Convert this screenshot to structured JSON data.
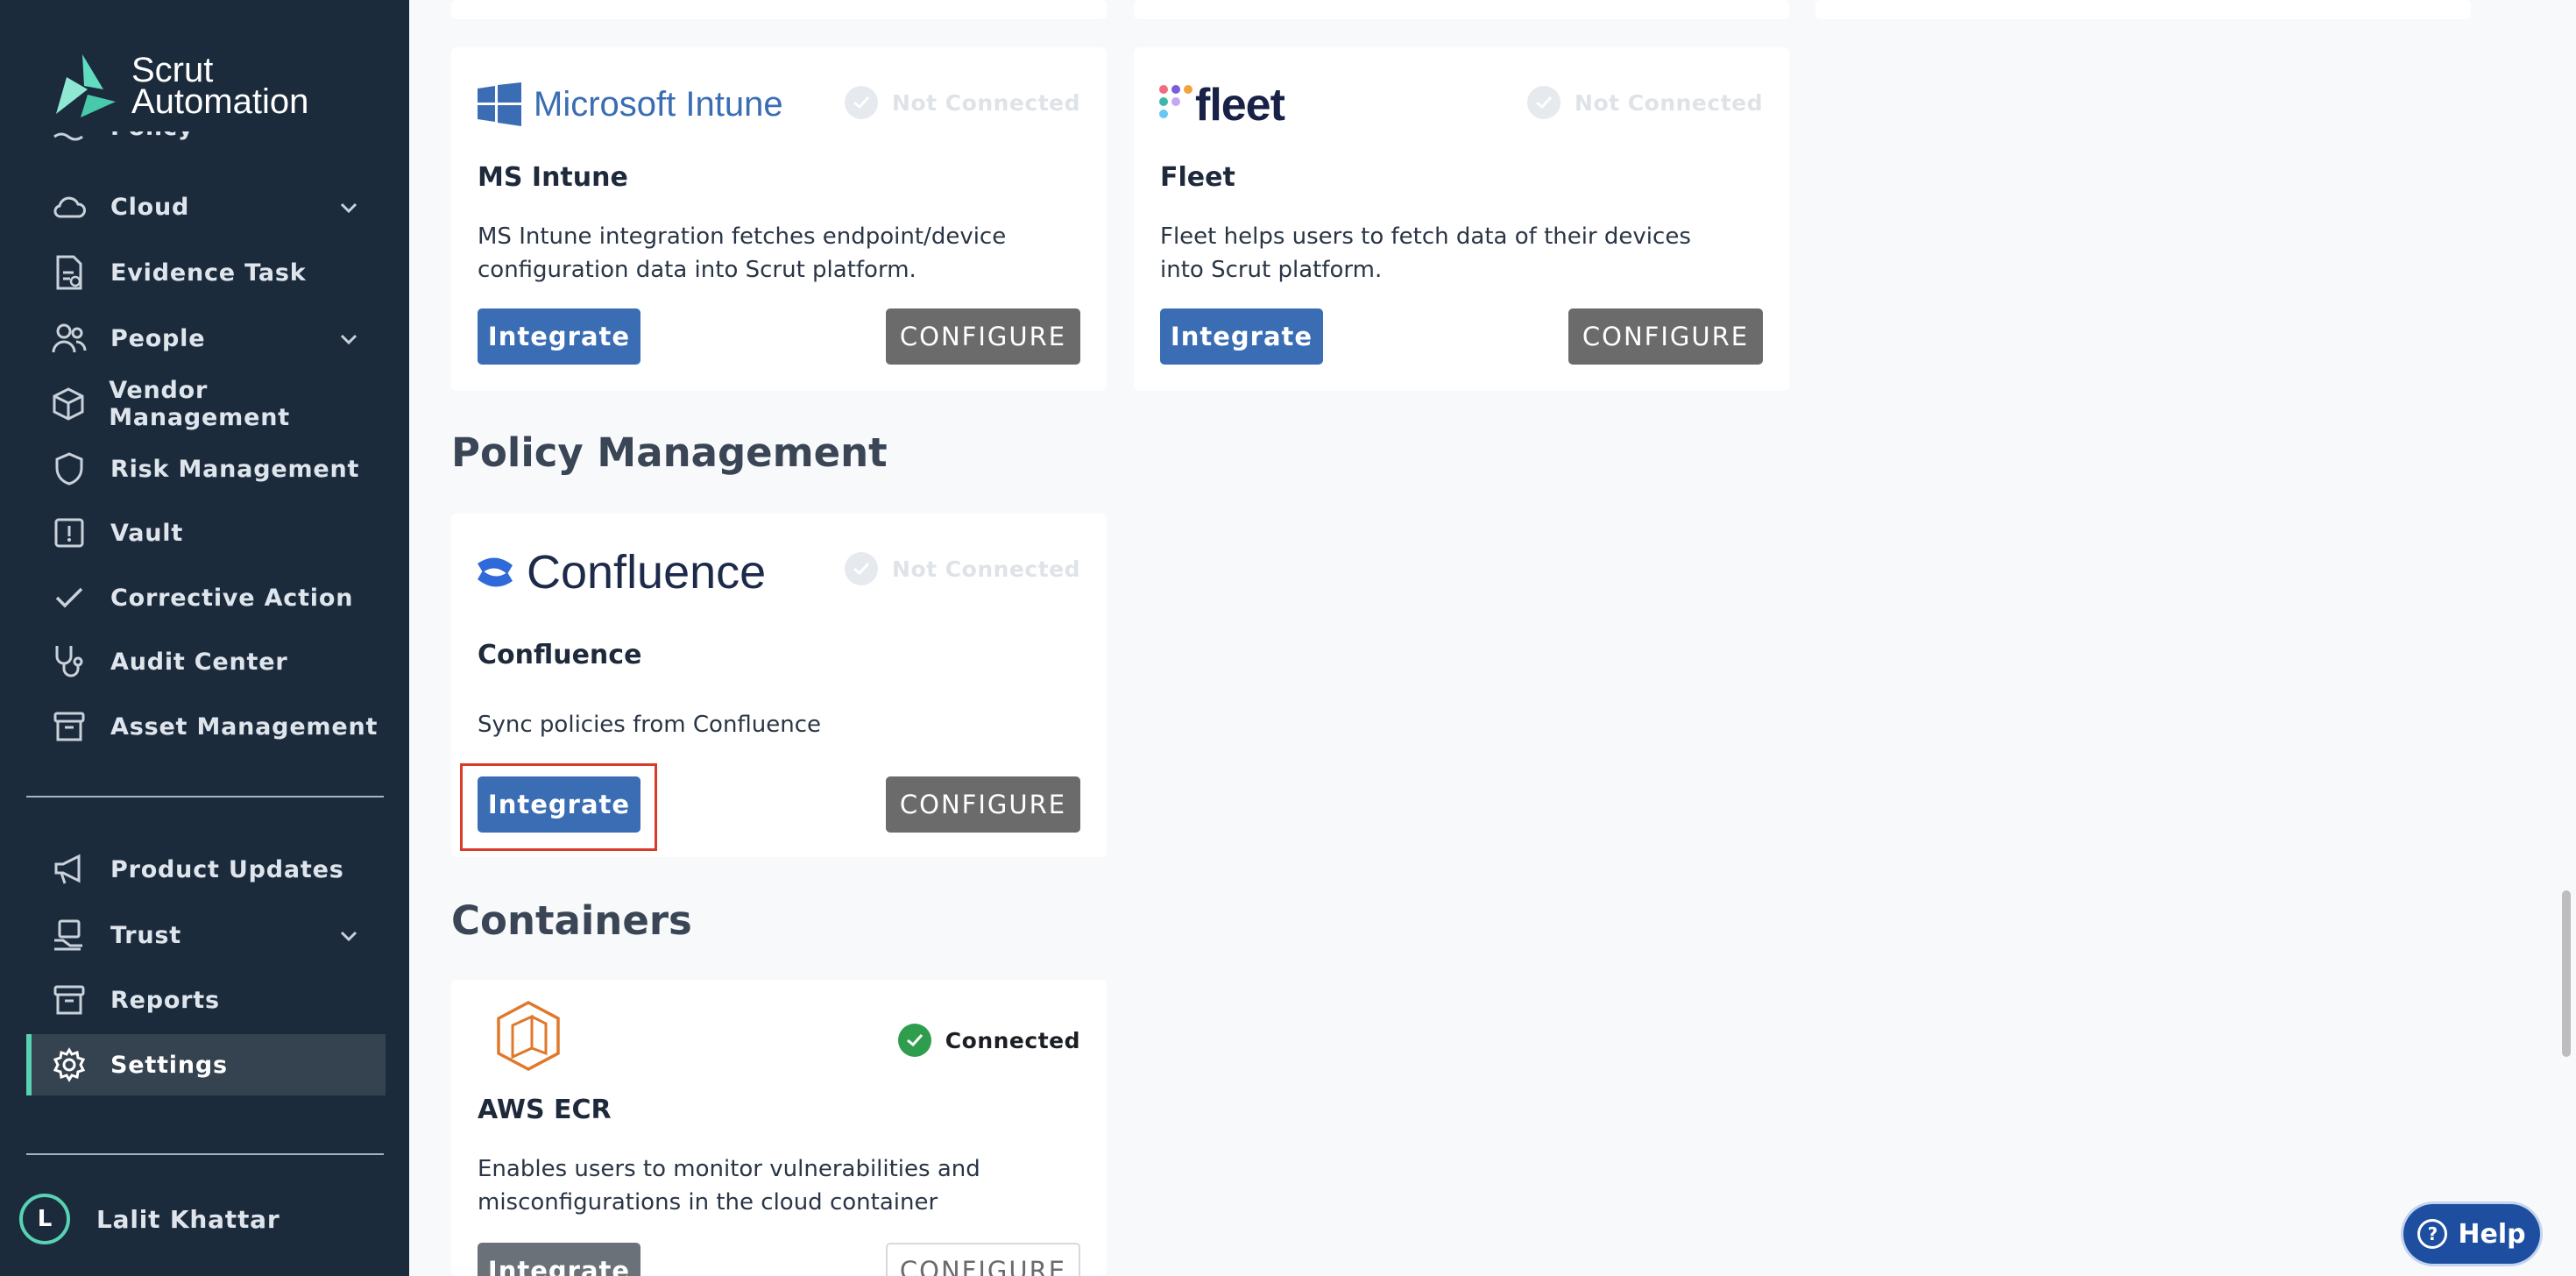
{
  "brand": {
    "line1": "Scrut",
    "line2": "Automation"
  },
  "sidebar": {
    "cut_label": "Policy",
    "items": [
      {
        "label": "Cloud",
        "icon": "cloud-icon",
        "expandable": true
      },
      {
        "label": "Evidence Task",
        "icon": "evidence-icon",
        "expandable": false
      },
      {
        "label": "People",
        "icon": "people-icon",
        "expandable": true
      },
      {
        "label": "Vendor Management",
        "icon": "box-icon",
        "expandable": false
      },
      {
        "label": "Risk Management",
        "icon": "shield-icon",
        "expandable": false
      },
      {
        "label": "Vault",
        "icon": "vault-icon",
        "expandable": false
      },
      {
        "label": "Corrective Action",
        "icon": "check-icon",
        "expandable": false
      },
      {
        "label": "Audit Center",
        "icon": "stethoscope-icon",
        "expandable": false
      },
      {
        "label": "Asset Management",
        "icon": "archive-icon",
        "expandable": false
      }
    ],
    "bottom_items": [
      {
        "label": "Product Updates",
        "icon": "megaphone-icon",
        "expandable": false
      },
      {
        "label": "Trust",
        "icon": "trust-icon",
        "expandable": true
      },
      {
        "label": "Reports",
        "icon": "reports-icon",
        "expandable": false
      },
      {
        "label": "Settings",
        "icon": "gear-icon",
        "expandable": false,
        "active": true
      }
    ],
    "user": {
      "initial": "L",
      "name": "Lalit Khattar"
    }
  },
  "cards": {
    "intune": {
      "logo_text": "Microsoft Intune",
      "status": "Not Connected",
      "title": "MS Intune",
      "desc": "MS Intune integration fetches endpoint/device configuration data into Scrut platform.",
      "integrate": "Integrate",
      "configure": "CONFIGURE"
    },
    "fleet": {
      "logo_text": "fleet",
      "status": "Not Connected",
      "title": "Fleet",
      "desc": "Fleet helps users to fetch data of their devices into Scrut platform.",
      "integrate": "Integrate",
      "configure": "CONFIGURE"
    },
    "confluence": {
      "logo_text": "Confluence",
      "status": "Not Connected",
      "title": "Confluence",
      "desc": "Sync policies from Confluence",
      "integrate": "Integrate",
      "configure": "CONFIGURE"
    },
    "ecr": {
      "status": "Connected",
      "title": "AWS ECR",
      "desc": "Enables users to monitor vulnerabilities and misconfigurations in the cloud container",
      "integrate": "Integrate",
      "configure": "CONFIGURE"
    }
  },
  "sections": {
    "policy": "Policy Management",
    "containers": "Containers"
  },
  "help": {
    "label": "Help"
  },
  "colors": {
    "sidebar_bg": "#1c2b3c",
    "accent": "#58d2b4",
    "primary_button": "#3a6db4",
    "configure_button": "#6b6b6b",
    "highlight": "#d93b2b",
    "connected": "#2f9d4e"
  }
}
